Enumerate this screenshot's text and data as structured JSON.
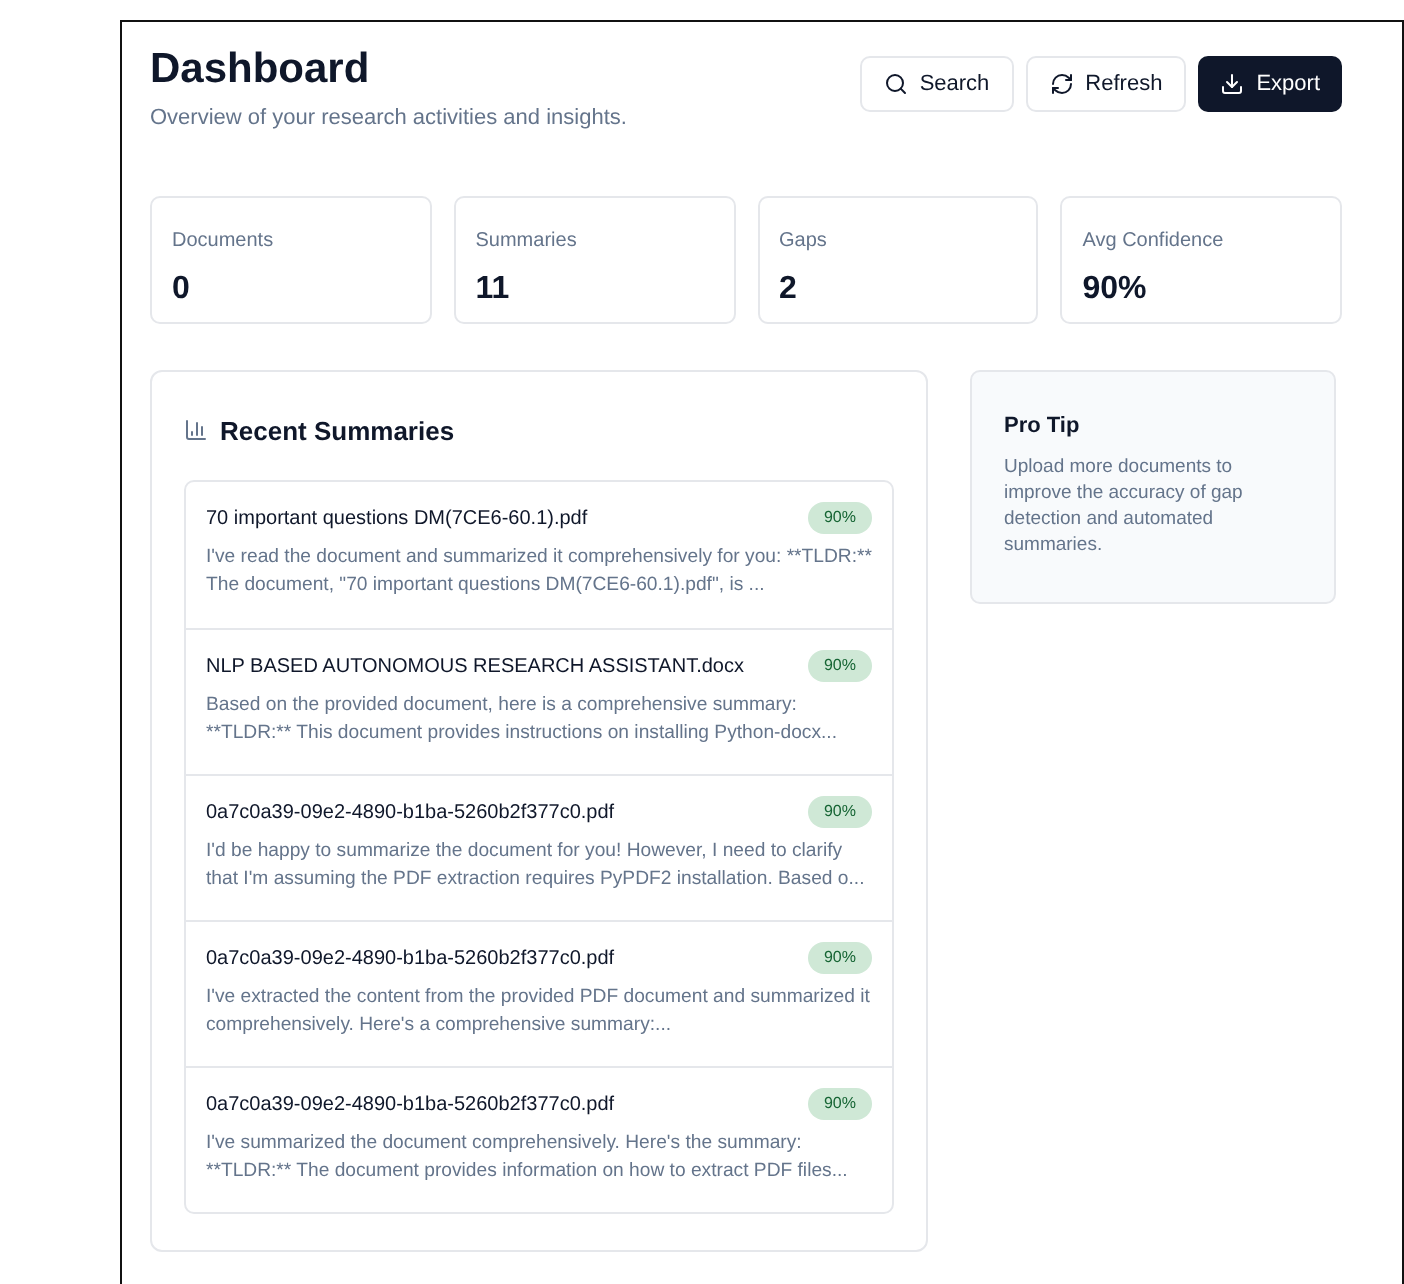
{
  "header": {
    "title": "Dashboard",
    "subtitle": "Overview of your research activities and insights."
  },
  "actions": [
    {
      "label": "Search",
      "kind": "search",
      "primary": false
    },
    {
      "label": "Refresh",
      "kind": "refresh",
      "primary": false
    },
    {
      "label": "Export",
      "kind": "export",
      "primary": true
    }
  ],
  "stats": [
    {
      "label": "Documents",
      "value": "0"
    },
    {
      "label": "Summaries",
      "value": "11"
    },
    {
      "label": "Gaps",
      "value": "2"
    },
    {
      "label": "Avg Confidence",
      "value": "90%"
    }
  ],
  "recent_summaries": {
    "title": "Recent Summaries",
    "items": [
      {
        "name": "70 important questions DM(7CE6-60.1).pdf",
        "confidence": "90%",
        "summary": "I've read the document and summarized it comprehensively for you: **TLDR:** The document, \"70 important questions DM(7CE6-60.1).pdf\", is ..."
      },
      {
        "name": "NLP BASED AUTONOMOUS RESEARCH ASSISTANT.docx",
        "confidence": "90%",
        "summary": "Based on the provided document, here is a comprehensive summary: **TLDR:** This document provides instructions on installing Python-docx..."
      },
      {
        "name": "0a7c0a39-09e2-4890-b1ba-5260b2f377c0.pdf",
        "confidence": "90%",
        "summary": "I'd be happy to summarize the document for you! However, I need to clarify that I'm assuming the PDF extraction requires PyPDF2 installation. Based o..."
      },
      {
        "name": "0a7c0a39-09e2-4890-b1ba-5260b2f377c0.pdf",
        "confidence": "90%",
        "summary": "I've extracted the content from the provided PDF document and summarized it comprehensively. Here's a comprehensive summary:..."
      },
      {
        "name": "0a7c0a39-09e2-4890-b1ba-5260b2f377c0.pdf",
        "confidence": "90%",
        "summary": "I've summarized the document comprehensively. Here's the summary: **TLDR:** The document provides information on how to extract PDF files..."
      }
    ]
  },
  "pro_tip": {
    "title": "Pro Tip",
    "text": "Upload more documents to improve the accuracy of gap detection and automated summaries."
  }
}
